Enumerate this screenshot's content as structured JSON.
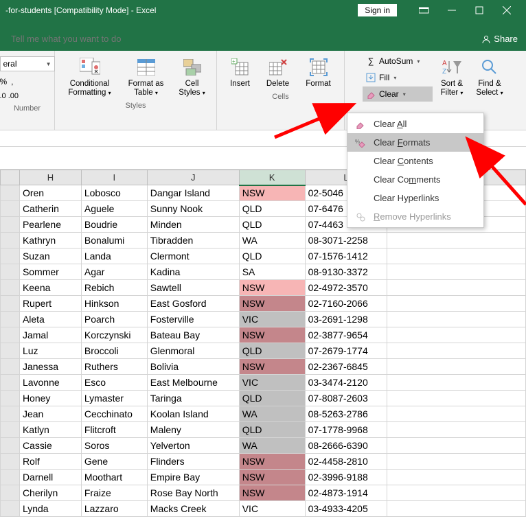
{
  "titlebar": {
    "title": "-for-students  [Compatibility Mode]  -  Excel",
    "signin": "Sign in",
    "share": "Share"
  },
  "tabstrip": {
    "tellme_placeholder": "Tell me what you want to do"
  },
  "ribbon": {
    "number": {
      "group_label": "Number",
      "format": "eral",
      "decimal_fmt": ".0  .00"
    },
    "styles": {
      "group_label": "Styles",
      "cf": "Conditional\nFormatting",
      "fat": "Format as\nTable",
      "cs": "Cell\nStyles"
    },
    "cells": {
      "group_label": "Cells",
      "insert": "Insert",
      "delete": "Delete",
      "format": "Format"
    },
    "editing": {
      "autosum": "AutoSum",
      "fill": "Fill",
      "clear": "Clear",
      "sortfilter": "Sort &\nFilter",
      "findselect": "Find &\nSelect"
    }
  },
  "clearmenu": {
    "all": "Clear All",
    "formats": "Clear Formats",
    "contents": "Clear Contents",
    "comments": "Clear Comments",
    "hyperlinks": "Clear Hyperlinks",
    "removehyper": "Remove Hyperlinks"
  },
  "columns": [
    "H",
    "I",
    "J",
    "K",
    "L"
  ],
  "rows": [
    {
      "h": "Oren",
      "i": "Lobosco",
      "j": "Dangar Island",
      "k": "NSW",
      "l": "02-5046",
      "kclass": "nsw-light"
    },
    {
      "h": "Catherin",
      "i": "Aguele",
      "j": "Sunny Nook",
      "k": "QLD",
      "l": "07-6476",
      "kclass": ""
    },
    {
      "h": "Pearlene",
      "i": "Boudrie",
      "j": "Minden",
      "k": "QLD",
      "l": "07-4463",
      "kclass": ""
    },
    {
      "h": "Kathryn",
      "i": "Bonalumi",
      "j": "Tibradden",
      "k": "WA",
      "l": "08-3071-2258",
      "kclass": ""
    },
    {
      "h": "Suzan",
      "i": "Landa",
      "j": "Clermont",
      "k": "QLD",
      "l": "07-1576-1412",
      "kclass": ""
    },
    {
      "h": "Sommer",
      "i": "Agar",
      "j": "Kadina",
      "k": "SA",
      "l": "08-9130-3372",
      "kclass": ""
    },
    {
      "h": "Keena",
      "i": "Rebich",
      "j": "Sawtell",
      "k": "NSW",
      "l": "02-4972-3570",
      "kclass": "nsw-light",
      "seltop": true
    },
    {
      "h": "Rupert",
      "i": "Hinkson",
      "j": "East Gosford",
      "k": "NSW",
      "l": "02-7160-2066",
      "kclass": "nsw-pink"
    },
    {
      "h": "Aleta",
      "i": "Poarch",
      "j": "Fosterville",
      "k": "VIC",
      "l": "03-2691-1298",
      "kclass": "graycell"
    },
    {
      "h": "Jamal",
      "i": "Korczynski",
      "j": "Bateau Bay",
      "k": "NSW",
      "l": "02-3877-9654",
      "kclass": "nsw-pink"
    },
    {
      "h": "Luz",
      "i": "Broccoli",
      "j": "Glenmoral",
      "k": "QLD",
      "l": "07-2679-1774",
      "kclass": "graycell"
    },
    {
      "h": "Janessa",
      "i": "Ruthers",
      "j": "Bolivia",
      "k": "NSW",
      "l": "02-2367-6845",
      "kclass": "nsw-pink"
    },
    {
      "h": "Lavonne",
      "i": "Esco",
      "j": "East Melbourne",
      "k": "VIC",
      "l": "03-3474-2120",
      "kclass": "graycell"
    },
    {
      "h": "Honey",
      "i": "Lymaster",
      "j": "Taringa",
      "k": "QLD",
      "l": "07-8087-2603",
      "kclass": "graycell"
    },
    {
      "h": "Jean",
      "i": "Cecchinato",
      "j": "Koolan Island",
      "k": "WA",
      "l": "08-5263-2786",
      "kclass": "graycell"
    },
    {
      "h": "Katlyn",
      "i": "Flitcroft",
      "j": "Maleny",
      "k": "QLD",
      "l": "07-1778-9968",
      "kclass": "graycell"
    },
    {
      "h": "Cassie",
      "i": "Soros",
      "j": "Yelverton",
      "k": "WA",
      "l": "08-2666-6390",
      "kclass": "graycell"
    },
    {
      "h": "Rolf",
      "i": "Gene",
      "j": "Flinders",
      "k": "NSW",
      "l": "02-4458-2810",
      "kclass": "nsw-pink"
    },
    {
      "h": "Darnell",
      "i": "Moothart",
      "j": "Empire Bay",
      "k": "NSW",
      "l": "02-3996-9188",
      "kclass": "nsw-pink"
    },
    {
      "h": "Cherilyn",
      "i": "Fraize",
      "j": "Rose Bay North",
      "k": "NSW",
      "l": "02-4873-1914",
      "kclass": "nsw-pink",
      "selbot": true
    },
    {
      "h": "Lynda",
      "i": "Lazzaro",
      "j": "Macks Creek",
      "k": "VIC",
      "l": "03-4933-4205",
      "kclass": ""
    }
  ]
}
